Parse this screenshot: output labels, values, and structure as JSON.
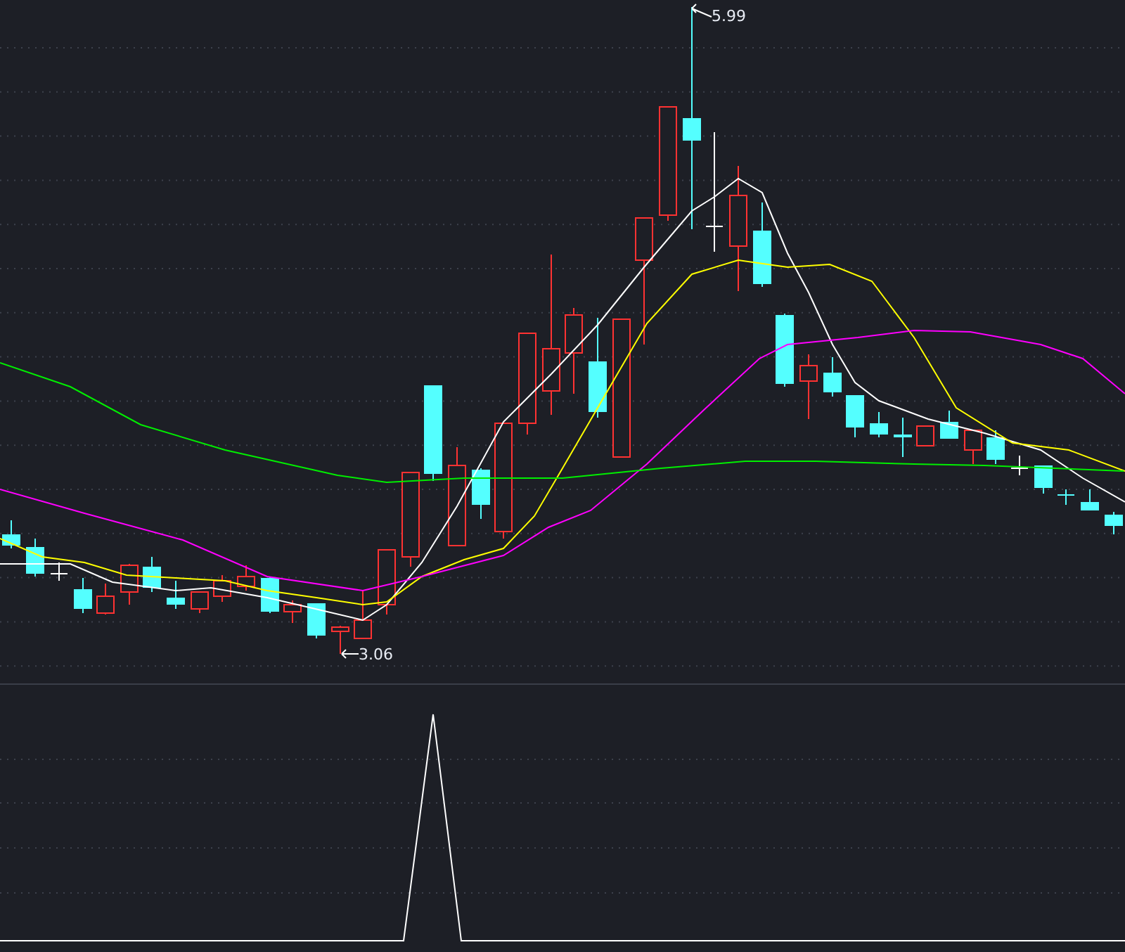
{
  "price_chart": {
    "high_label": "5.99",
    "low_label": "3.06"
  }
}
